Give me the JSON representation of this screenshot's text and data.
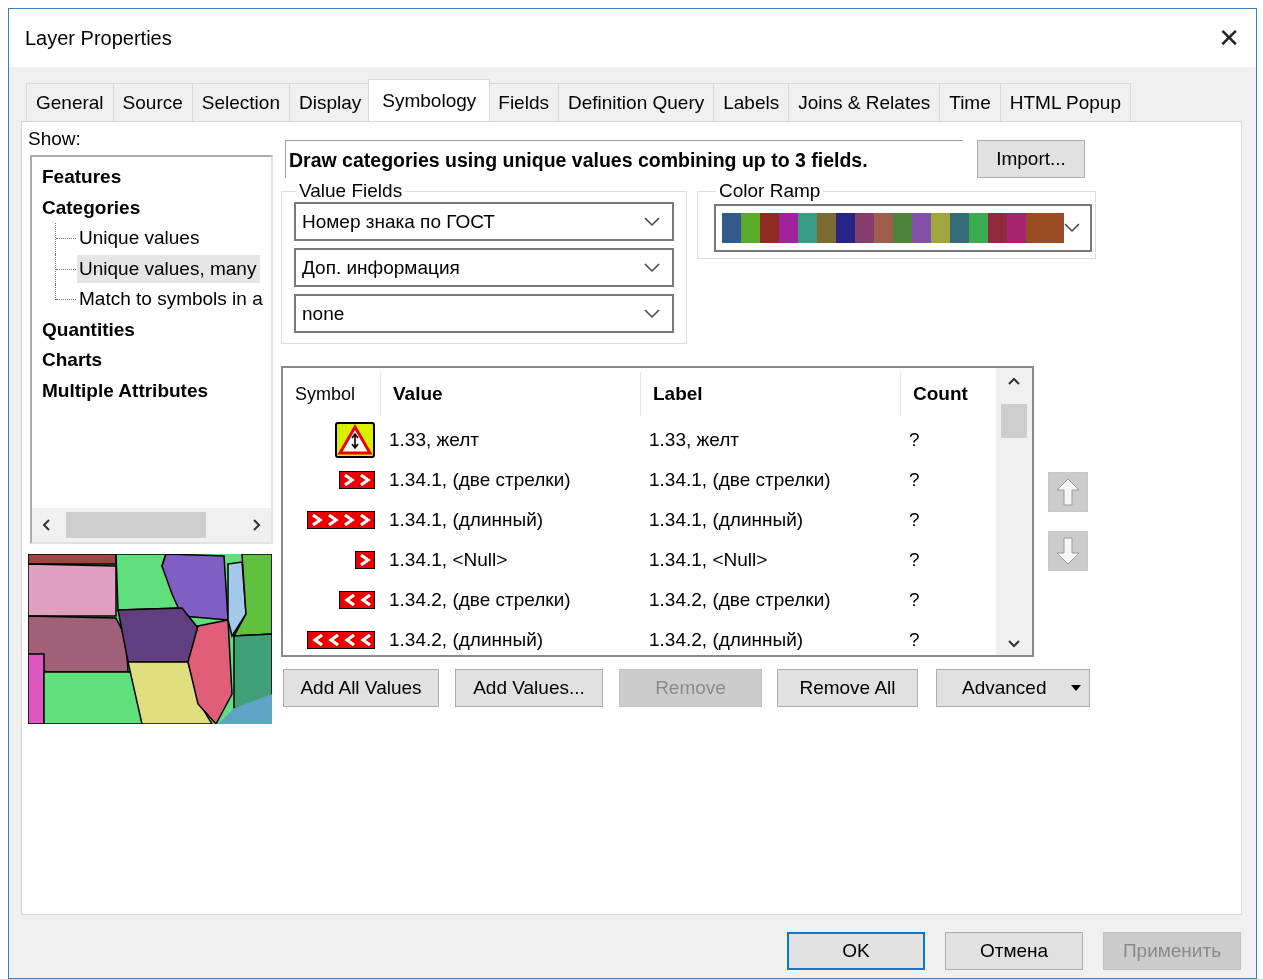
{
  "window": {
    "title": "Layer Properties",
    "close": "✕"
  },
  "tabs": [
    {
      "label": "General",
      "selected": false
    },
    {
      "label": "Source",
      "selected": false
    },
    {
      "label": "Selection",
      "selected": false
    },
    {
      "label": "Display",
      "selected": false
    },
    {
      "label": "Symbology",
      "selected": true
    },
    {
      "label": "Fields",
      "selected": false
    },
    {
      "label": "Definition Query",
      "selected": false
    },
    {
      "label": "Labels",
      "selected": false
    },
    {
      "label": "Joins & Relates",
      "selected": false
    },
    {
      "label": "Time",
      "selected": false
    },
    {
      "label": "HTML Popup",
      "selected": false
    }
  ],
  "show": {
    "label": "Show:",
    "tree": [
      {
        "label": "Features",
        "selected": false
      },
      {
        "label": "Categories",
        "selected": false,
        "children": [
          {
            "label": "Unique values",
            "selected": false
          },
          {
            "label": "Unique values, many",
            "selected": true
          },
          {
            "label": "Match to symbols in a",
            "selected": false
          }
        ]
      },
      {
        "label": "Quantities",
        "selected": false
      },
      {
        "label": "Charts",
        "selected": false
      },
      {
        "label": "Multiple Attributes",
        "selected": false
      }
    ]
  },
  "description": "Draw categories using unique values combining up to 3 fields.",
  "import_button": "Import...",
  "value_fields": {
    "title": "Value Fields",
    "fields": [
      "Номер знака по ГОСТ",
      "Доп. информация",
      "none"
    ]
  },
  "color_ramp": {
    "title": "Color Ramp",
    "swatches": [
      {
        "color": "#335a8c"
      },
      {
        "color": "#5aab2a"
      },
      {
        "color": "#8f2b22"
      },
      {
        "color": "#a0229e"
      },
      {
        "color": "#3a9c85"
      },
      {
        "color": "#7d6a30"
      },
      {
        "color": "#262585"
      },
      {
        "color": "#853e6b"
      },
      {
        "color": "#9e5e4e"
      },
      {
        "color": "#4c843a"
      },
      {
        "color": "#8250a8"
      },
      {
        "color": "#a0a63a"
      },
      {
        "color": "#356c78"
      },
      {
        "color": "#39ae50"
      },
      {
        "color": "#912a40"
      },
      {
        "color": "#a6246e"
      },
      {
        "color": "#994c24"
      }
    ]
  },
  "table": {
    "columns": [
      {
        "label": "Symbol",
        "bold": false
      },
      {
        "label": "Value",
        "bold": true
      },
      {
        "label": "Label",
        "bold": true
      },
      {
        "label": "Count",
        "bold": true
      }
    ],
    "rows": [
      {
        "symbol": {
          "kind": "warning"
        },
        "value": "1.33, желт",
        "label": "1.33, желт",
        "count": "?"
      },
      {
        "symbol": {
          "kind": "double-right"
        },
        "value": "1.34.1, (две стрелки)",
        "label": "1.34.1, (две стрелки)",
        "count": "?"
      },
      {
        "symbol": {
          "kind": "long-right"
        },
        "value": "1.34.1, (длинный)",
        "label": "1.34.1, (длинный)",
        "count": "?"
      },
      {
        "symbol": {
          "kind": "single-right"
        },
        "value": "1.34.1, <Null>",
        "label": "1.34.1, <Null>",
        "count": "?"
      },
      {
        "symbol": {
          "kind": "double-left"
        },
        "value": "1.34.2, (две стрелки)",
        "label": "1.34.2, (две стрелки)",
        "count": "?"
      },
      {
        "symbol": {
          "kind": "long-left"
        },
        "value": "1.34.2, (длинный)",
        "label": "1.34.2, (длинный)",
        "count": "?"
      }
    ]
  },
  "move_buttons": [
    {
      "kind": "up",
      "disabled": true
    },
    {
      "kind": "down",
      "disabled": true
    }
  ],
  "table_buttons": [
    {
      "label": "Add All Values",
      "disabled": false
    },
    {
      "label": "Add Values...",
      "disabled": false
    },
    {
      "label": "Remove",
      "disabled": true
    },
    {
      "label": "Remove All",
      "disabled": false
    },
    {
      "label": "Advanced",
      "disabled": false,
      "dropdown": true
    }
  ],
  "dialog_buttons": [
    {
      "label": "OK",
      "default": true,
      "disabled": false
    },
    {
      "label": "Отмена",
      "default": false,
      "disabled": false
    },
    {
      "label": "Применить",
      "default": false,
      "disabled": true
    }
  ]
}
